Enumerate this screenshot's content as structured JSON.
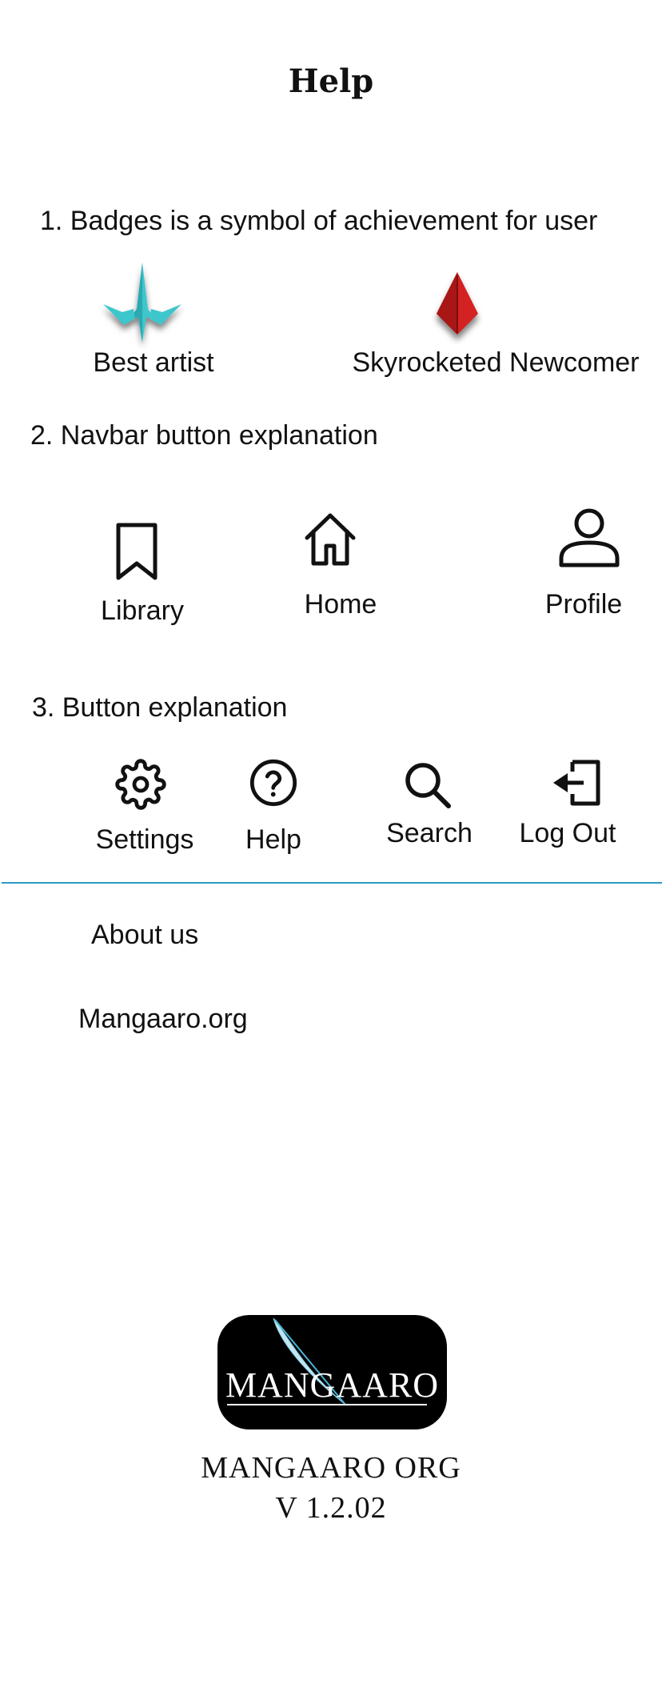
{
  "header": {
    "title": "Help"
  },
  "sections": {
    "badges": {
      "heading": "1.  Badges is a symbol of achievement for user",
      "items": [
        {
          "label": "Best artist",
          "icon": "teal-spire-badge-icon",
          "color": "#3cc6cc"
        },
        {
          "label": "Skyrocketed Newcomer",
          "icon": "red-crystal-badge-icon",
          "color": "#c81a1a"
        }
      ]
    },
    "navbar": {
      "heading": "2. Navbar button explanation",
      "items": [
        {
          "label": "Library",
          "icon": "bookmark-icon"
        },
        {
          "label": "Home",
          "icon": "home-icon"
        },
        {
          "label": "Profile",
          "icon": "user-icon"
        }
      ]
    },
    "buttons": {
      "heading": "3. Button explanation",
      "items": [
        {
          "label": "Settings",
          "icon": "gear-icon"
        },
        {
          "label": "Help",
          "icon": "question-circle-icon"
        },
        {
          "label": "Search",
          "icon": "search-icon"
        },
        {
          "label": "Log Out",
          "icon": "logout-icon"
        }
      ]
    }
  },
  "footer": {
    "about_label": "About us",
    "site_label": "Mangaaro.org",
    "logo_text": "MANGAARO",
    "org_name": "MANGAARO ORG",
    "version": "V 1.2.02",
    "accent_color": "#2e9cc4"
  }
}
